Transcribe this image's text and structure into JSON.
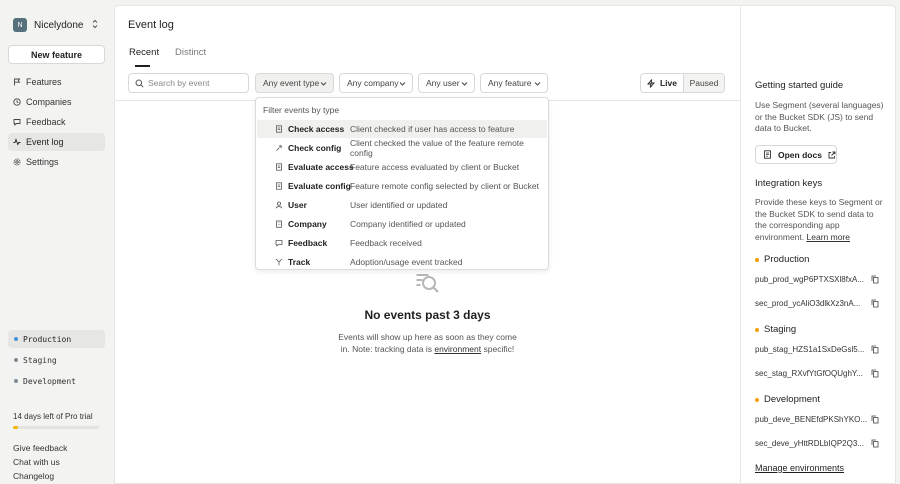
{
  "org": {
    "initial": "N",
    "name": "Nicelydone"
  },
  "sidebar": {
    "new_feature": "New feature",
    "nav": [
      {
        "label": "Features",
        "icon": "flag-icon"
      },
      {
        "label": "Companies",
        "icon": "building-icon"
      },
      {
        "label": "Feedback",
        "icon": "chat-icon"
      },
      {
        "label": "Event log",
        "icon": "pulse-icon",
        "active": true
      },
      {
        "label": "Settings",
        "icon": "gear-icon"
      }
    ],
    "environments": [
      {
        "label": "Production",
        "color": "#4a8fd6",
        "active": true
      },
      {
        "label": "Staging",
        "color": "#7f8c96"
      },
      {
        "label": "Development",
        "color": "#7f8c96"
      }
    ],
    "trial": {
      "text": "14 days left of Pro trial",
      "progress_percent": 6,
      "color": "#f5b400"
    },
    "footer": [
      "Give feedback",
      "Chat with us",
      "Changelog"
    ]
  },
  "main": {
    "title": "Event log",
    "tabs": [
      {
        "label": "Recent",
        "active": true
      },
      {
        "label": "Distinct"
      }
    ],
    "search": {
      "placeholder": "Search by event",
      "value": ""
    },
    "filters": [
      "Any event type",
      "Any company",
      "Any user",
      "Any feature"
    ],
    "live": "Live",
    "paused": "Paused",
    "empty": {
      "title": "No events past 3 days",
      "line1": "Events will show up here as soon as they come",
      "line2_pre": "in. Note: tracking data is",
      "line2_link": "environment",
      "line2_post": "specific!"
    }
  },
  "dropdown": {
    "filter_label": "Filter events by type",
    "items": [
      {
        "name": "Check access",
        "desc": "Client checked if user has access to feature",
        "icon": "document-icon"
      },
      {
        "name": "Check config",
        "desc": "Client checked the value of the feature remote config",
        "icon": "tool-icon"
      },
      {
        "name": "Evaluate access",
        "desc": "Feature access evaluated by client or Bucket",
        "icon": "document-icon"
      },
      {
        "name": "Evaluate config",
        "desc": "Feature remote config selected by client or Bucket",
        "icon": "document-icon"
      },
      {
        "name": "User",
        "desc": "User identified or updated",
        "icon": "user-icon"
      },
      {
        "name": "Company",
        "desc": "Company identified or updated",
        "icon": "building-icon"
      },
      {
        "name": "Feedback",
        "desc": "Feedback received",
        "icon": "chat-icon"
      },
      {
        "name": "Track",
        "desc": "Adoption/usage event tracked",
        "icon": "track-icon"
      }
    ]
  },
  "right_panel": {
    "guide_title": "Getting started guide",
    "guide_text": "Use Segment (several languages) or the Bucket SDK (JS) to send data to Bucket.",
    "open_docs": "Open docs",
    "keys_title": "Integration keys",
    "keys_text": "Provide these keys to Segment or the Bucket SDK to send data to the corresponding app environment.",
    "learn_more": "Learn more",
    "envs": [
      {
        "name": "Production",
        "color": "#f5a000",
        "pub": "pub_prod_wgP6PTXSXl8fxA...",
        "sec": "sec_prod_ycAliO3dlkXz3nA..."
      },
      {
        "name": "Staging",
        "color": "#f5a000",
        "pub": "pub_stag_HZS1a1SxDeGsl5...",
        "sec": "sec_stag_RXvfYtGfOQUghY..."
      },
      {
        "name": "Development",
        "color": "#f5a000",
        "pub": "pub_deve_BENEfdPKShYKO...",
        "sec": "sec_deve_yHttRDLbIQP2Q3..."
      }
    ],
    "manage": "Manage environments"
  }
}
